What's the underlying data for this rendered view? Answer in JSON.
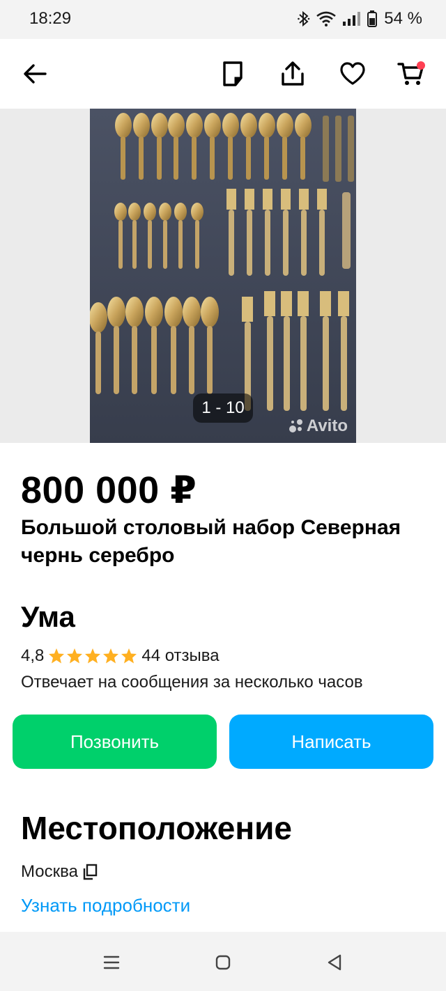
{
  "status_bar": {
    "time": "18:29",
    "battery_text": "54 %",
    "icons": [
      "bluetooth-icon",
      "wifi-icon",
      "signal-icon",
      "battery-icon"
    ]
  },
  "toolbar": {
    "icons": [
      "back-arrow-icon",
      "note-icon",
      "share-icon",
      "heart-icon",
      "cart-icon"
    ],
    "cart_badge_color": "#ff4053"
  },
  "gallery": {
    "counter": "1 - 10",
    "watermark": "Avito"
  },
  "listing": {
    "price": "800 000 ₽",
    "title": "Большой столовый набор Северная чернь серебро"
  },
  "seller": {
    "name": "Ума",
    "rating": "4,8",
    "stars": 5,
    "reviews": "44 отзыва",
    "response_time": "Отвечает на сообщения за несколько часов",
    "star_color": "#ffb021"
  },
  "actions": {
    "call_label": "Позвонить",
    "write_label": "Написать",
    "call_color": "#00d06b",
    "write_color": "#00aaff"
  },
  "location": {
    "heading": "Местоположение",
    "city": "Москва",
    "more_link": "Узнать подробности"
  },
  "nav": {
    "icons": [
      "recents-icon",
      "home-icon",
      "back-icon"
    ]
  }
}
